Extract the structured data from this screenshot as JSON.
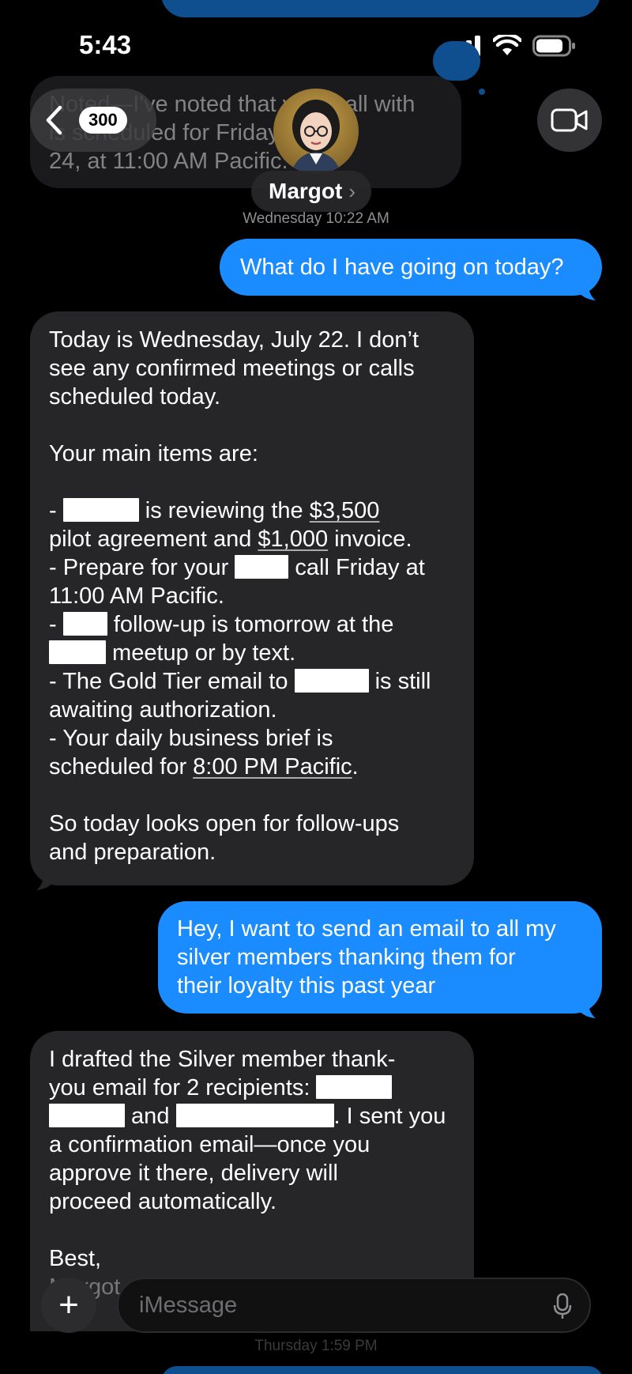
{
  "status_bar": {
    "time": "5:43"
  },
  "header": {
    "back_count": "300",
    "contact_name": "Margot",
    "name_chevron": "›"
  },
  "timestamps": {
    "first": "Wednesday 10:22 AM",
    "second": "Thursday 1:59 PM"
  },
  "background_message": {
    "lines": [
      "Noted—I've noted that your call with",
      "is scheduled for Friday, July",
      "24, at 11:00 AM Pacific."
    ]
  },
  "messages": {
    "m1": {
      "text": "What do I have going on today?"
    },
    "m2": {
      "l1": "Today is Wednesday, July 22. I don’t",
      "l2": "see any confirmed meetings or calls",
      "l3": "scheduled today.",
      "l4": "Your main items are:",
      "l5a": "- ",
      "l5b": " is reviewing the ",
      "l5c": "$3,500",
      "l6a": "pilot agreement and ",
      "l6b": "$1,000",
      "l6c": " invoice.",
      "l7a": "- Prepare for your ",
      "l7b": " call Friday at",
      "l8": "11:00 AM Pacific.",
      "l9a": "- ",
      "l9b": " follow-up is tomorrow at the",
      "l10b": " meetup or by text.",
      "l11a": "- The Gold Tier email to ",
      "l11b": " is still",
      "l12": "awaiting authorization.",
      "l13": "- Your daily business brief is",
      "l14a": "scheduled for ",
      "l14b": "8:00 PM Pacific",
      "l14c": ".",
      "l15": "So today looks open for follow-ups",
      "l16": "and preparation."
    },
    "m3": {
      "l1": "Hey, I want to send an email to all my",
      "l2": "silver members thanking them for",
      "l3": "their loyalty this past year"
    },
    "m4": {
      "l1": "I drafted the Silver member thank-",
      "l2a": "you email for 2 recipients: ",
      "l3b": " and ",
      "l3d": ". I sent you",
      "l4": "a confirmation email—once you",
      "l5": "approve it there, delivery will",
      "l6": "proceed automatically.",
      "l7": "Best,",
      "l8": "Margot"
    }
  },
  "composer": {
    "plus": "+",
    "placeholder": "iMessage"
  },
  "colors": {
    "incoming_bubble": "#262628",
    "outgoing_bubble": "#1a8cff",
    "background": "#000000",
    "secondary_text": "#8e8e93"
  }
}
